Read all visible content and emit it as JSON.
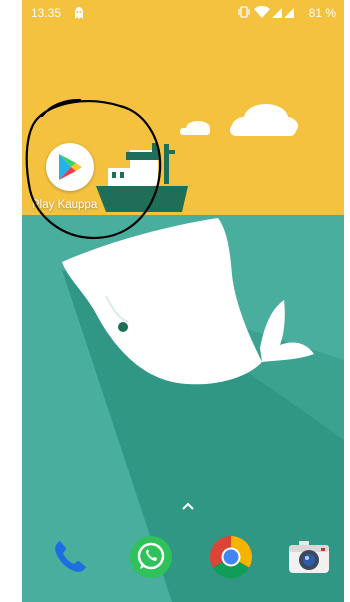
{
  "status_bar": {
    "time": "13.35",
    "battery": "81 %"
  },
  "home": {
    "apps": [
      {
        "label": "Play Kauppa",
        "icon": "google-play-icon"
      }
    ]
  },
  "dock": [
    {
      "icon": "phone-icon"
    },
    {
      "icon": "whatsapp-icon"
    },
    {
      "icon": "chrome-icon"
    },
    {
      "icon": "camera-icon"
    }
  ],
  "colors": {
    "sky": "#f4c23f",
    "sea": "#4aae9e",
    "sea_dark": "#2f9783",
    "whale": "#ffffff",
    "ship": "#1f6e57"
  }
}
